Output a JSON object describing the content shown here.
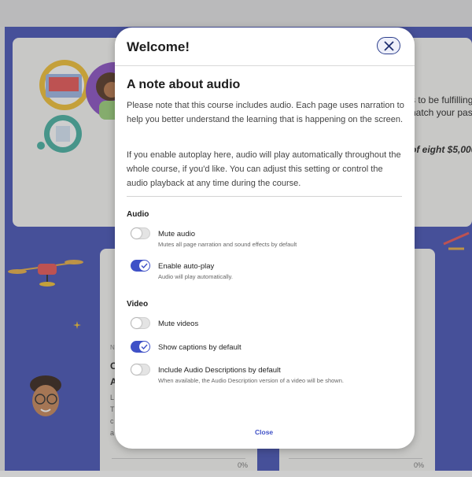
{
  "background": {
    "text_lines": [
      "s to be fulfilling",
      "natch your pas",
      "of eight $5,000"
    ],
    "left_fragments": [
      "C",
      "A",
      "L",
      "T",
      "c",
      "a",
      "h"
    ],
    "small_marker": "N",
    "progress_left": "0%",
    "progress_right": "0%"
  },
  "modal": {
    "title": "Welcome!",
    "close_icon": "close-icon",
    "heading": "A note about audio",
    "intro_paragraph": "Please note that this course includes audio. Each page uses narration to help you better understand the learning that is happening on the screen.",
    "autoplay_paragraph": "If you enable autoplay here, audio will play automatically throughout the whole course, if you'd like. You can adjust this setting or control the audio playback at any time during the course.",
    "audio_section": {
      "title": "Audio",
      "options": [
        {
          "label": "Mute audio",
          "description": "Mutes all page narration and sound effects by default",
          "enabled": false
        },
        {
          "label": "Enable auto-play",
          "description": "Audio will play automatically.",
          "enabled": true
        }
      ]
    },
    "video_section": {
      "title": "Video",
      "options": [
        {
          "label": "Mute videos",
          "description": "",
          "enabled": false
        },
        {
          "label": "Show captions by default",
          "description": "",
          "enabled": true
        },
        {
          "label": "Include Audio Descriptions by default",
          "description": "When available, the Audio Description version of a video will be shown.",
          "enabled": false
        }
      ]
    },
    "close_label": "Close"
  },
  "colors": {
    "accent": "#3f51c7",
    "background_blue": "#4a57b8",
    "toggle_off": "#e4e4e4"
  }
}
